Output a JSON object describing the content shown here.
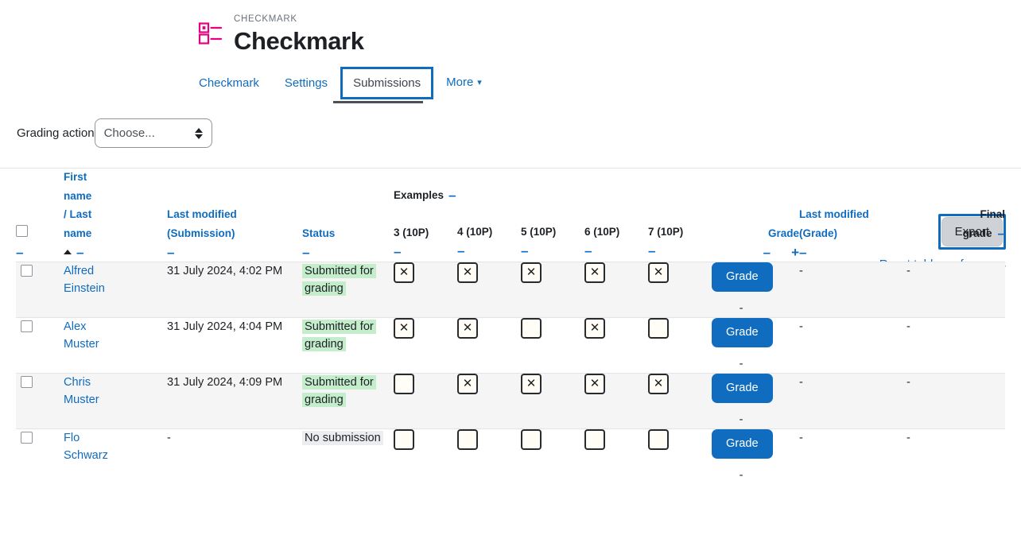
{
  "header": {
    "eyebrow": "CHECKMARK",
    "title": "Checkmark",
    "icon": "checkmark-list-icon",
    "icon_color": "#e6007e"
  },
  "tabs": [
    {
      "label": "Checkmark",
      "active": false
    },
    {
      "label": "Settings",
      "active": false
    },
    {
      "label": "Submissions",
      "active": true
    },
    {
      "label": "More",
      "active": false,
      "chevron": "⌄"
    }
  ],
  "toolbar": {
    "grading_action_label": "Grading action",
    "grading_action_value": "Choose...",
    "export_label": "Export",
    "reset_link": "Reset table preferences",
    "accent_color": "#0f6cbf"
  },
  "table": {
    "headers": {
      "select_all": "select-all-checkbox",
      "name": "First name / Last name",
      "name_lines": [
        "First",
        "name",
        "/ Last",
        "name"
      ],
      "last_modified_submission": [
        "Last modified",
        "(Submission)"
      ],
      "status": "Status",
      "examples_group": "Examples",
      "examples": [
        "3 (10P)",
        "4 (10P)",
        "5 (10P)",
        "6 (10P)",
        "7 (10P)"
      ],
      "grade": "Grade",
      "last_modified_grade": [
        "Last modified",
        "(Grade)"
      ],
      "final_grade": [
        "Final",
        "grade"
      ],
      "collapse_icon": "–",
      "expand_icon": "+",
      "sort_icon": "sort-ascending-icon"
    },
    "rows": [
      {
        "first_name": "Alfred",
        "last_name": "Einstein",
        "last_modified_submission": "31 July 2024, 4:02 PM",
        "status": "Submitted for grading",
        "status_kind": "green",
        "examples": [
          "x",
          "x",
          "x",
          "x",
          "x"
        ],
        "grade_button": "Grade",
        "grade_sub": "-",
        "last_modified_grade": "-",
        "final_grade": "-"
      },
      {
        "first_name": "Alex",
        "last_name": "Muster",
        "last_modified_submission": "31 July 2024, 4:04 PM",
        "status": "Submitted for grading",
        "status_kind": "green",
        "examples": [
          "x",
          "x",
          "",
          "x",
          ""
        ],
        "grade_button": "Grade",
        "grade_sub": "-",
        "last_modified_grade": "-",
        "final_grade": "-"
      },
      {
        "first_name": "Chris",
        "last_name": "Muster",
        "last_modified_submission": "31 July 2024, 4:09 PM",
        "status": "Submitted for grading",
        "status_kind": "green",
        "examples": [
          "",
          "x",
          "x",
          "x",
          "x"
        ],
        "grade_button": "Grade",
        "grade_sub": "-",
        "last_modified_grade": "-",
        "final_grade": "-"
      },
      {
        "first_name": "Flo",
        "last_name": "Schwarz",
        "last_modified_submission": "-",
        "status": "No submission",
        "status_kind": "gray",
        "examples": [
          "",
          "",
          "",
          "",
          ""
        ],
        "grade_button": "Grade",
        "grade_sub": "-",
        "last_modified_grade": "-",
        "final_grade": "-"
      }
    ]
  }
}
